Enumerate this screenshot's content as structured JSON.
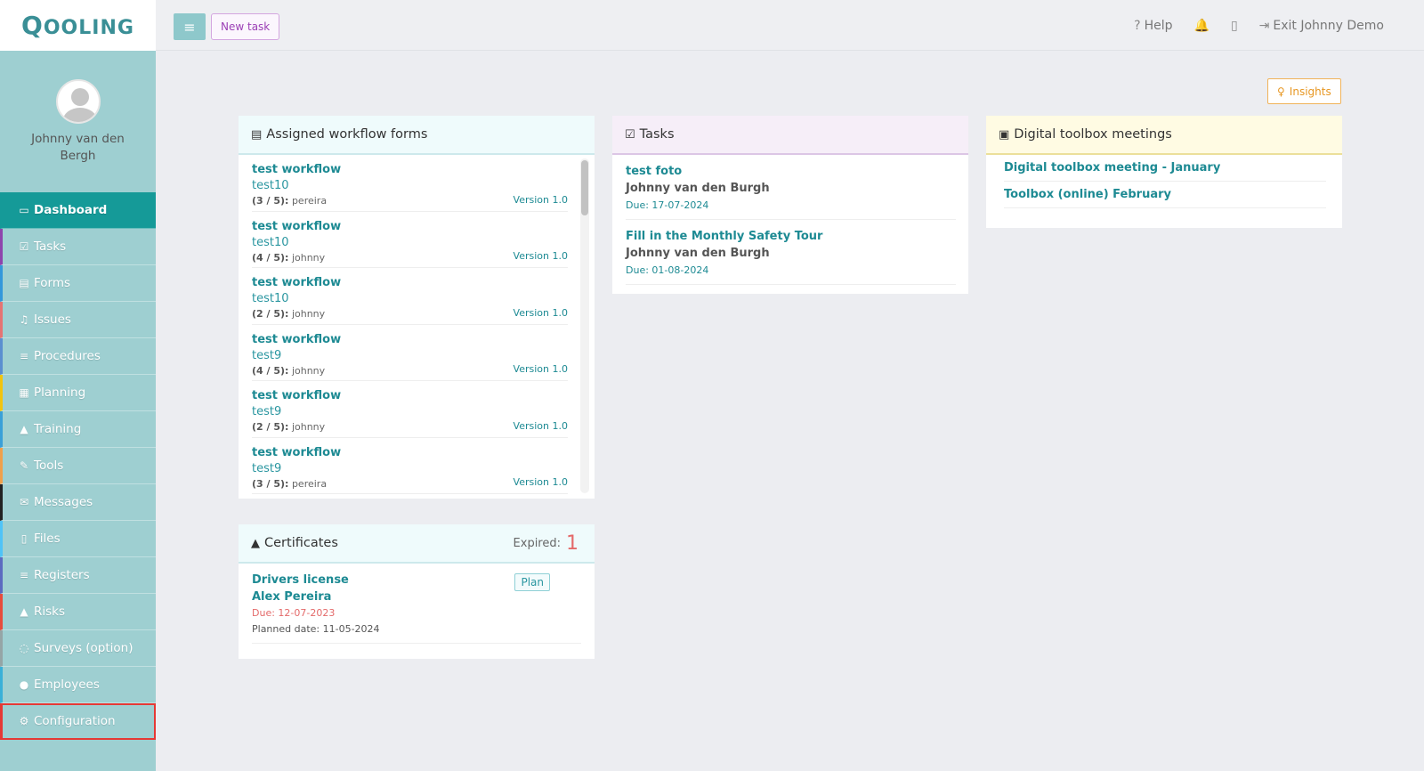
{
  "logo": {
    "first": "Q",
    "rest": "OOLING"
  },
  "topbar": {
    "new_task_label": "New task",
    "help_label": "Help",
    "exit_label": "Exit Johnny Demo"
  },
  "profile": {
    "name": "Johnny van den Bergh"
  },
  "sidebar": {
    "items": [
      {
        "label": "Dashboard",
        "icon": "desktop-icon",
        "glyph": "▭",
        "color": "#159a98"
      },
      {
        "label": "Tasks",
        "icon": "check-square-icon",
        "glyph": "☑",
        "color": "#8e44ad"
      },
      {
        "label": "Forms",
        "icon": "document-icon",
        "glyph": "▤",
        "color": "#3498db"
      },
      {
        "label": "Issues",
        "icon": "bell-icon",
        "glyph": "♫",
        "color": "#e57373"
      },
      {
        "label": "Procedures",
        "icon": "list-icon",
        "glyph": "≡",
        "color": "#5b8fd0"
      },
      {
        "label": "Planning",
        "icon": "calendar-icon",
        "glyph": "▦",
        "color": "#f1c40f"
      },
      {
        "label": "Training",
        "icon": "graduation-cap-icon",
        "glyph": "▲",
        "color": "#3aa0d8"
      },
      {
        "label": "Tools",
        "icon": "wrench-icon",
        "glyph": "✎",
        "color": "#f0a04b"
      },
      {
        "label": "Messages",
        "icon": "envelope-icon",
        "glyph": "✉",
        "color": "#222222"
      },
      {
        "label": "Files",
        "icon": "file-icon",
        "glyph": "▯",
        "color": "#4fc3f7"
      },
      {
        "label": "Registers",
        "icon": "list-icon",
        "glyph": "≡",
        "color": "#5c6bc0"
      },
      {
        "label": "Risks",
        "icon": "warning-icon",
        "glyph": "▲",
        "color": "#e74c3c"
      },
      {
        "label": "Surveys (option)",
        "icon": "comment-icon",
        "glyph": "◌",
        "color": "#95a5a6"
      },
      {
        "label": "Employees",
        "icon": "users-icon",
        "glyph": "●",
        "color": "#3ab0d8"
      },
      {
        "label": "Configuration",
        "icon": "gear-icon",
        "glyph": "⚙",
        "color": "#e53935"
      }
    ]
  },
  "insights_label": "Insights",
  "workflow_panel": {
    "title": "Assigned workflow forms",
    "items": [
      {
        "title": "test workflow",
        "sub": "test10",
        "progress": "(3 / 5):",
        "user": "pereira",
        "version": "Version 1.0"
      },
      {
        "title": "test workflow",
        "sub": "test10",
        "progress": "(4 / 5):",
        "user": "johnny",
        "version": "Version 1.0"
      },
      {
        "title": "test workflow",
        "sub": "test10",
        "progress": "(2 / 5):",
        "user": "johnny",
        "version": "Version 1.0"
      },
      {
        "title": "test workflow",
        "sub": "test9",
        "progress": "(4 / 5):",
        "user": "johnny",
        "version": "Version 1.0"
      },
      {
        "title": "test workflow",
        "sub": "test9",
        "progress": "(2 / 5):",
        "user": "johnny",
        "version": "Version 1.0"
      },
      {
        "title": "test workflow",
        "sub": "test9",
        "progress": "(3 / 5):",
        "user": "pereira",
        "version": "Version 1.0"
      }
    ]
  },
  "tasks_panel": {
    "title": "Tasks",
    "items": [
      {
        "title": "test foto",
        "who": "Johnny van den Burgh",
        "due": "Due: 17-07-2024"
      },
      {
        "title": "Fill in the Monthly Safety Tour",
        "who": "Johnny van den Burgh",
        "due": "Due: 01-08-2024"
      }
    ]
  },
  "toolbox_panel": {
    "title": "Digital toolbox meetings",
    "items": [
      "Digital toolbox meeting - January",
      "Toolbox (online) February"
    ]
  },
  "certificates_panel": {
    "title": "Certificates",
    "expired_label": "Expired:",
    "expired_count": "1",
    "items": [
      {
        "title": "Drivers license",
        "who": "Alex Pereira",
        "due": "Due: 12-07-2023",
        "planned": "Planned date: 11-05-2024",
        "badge": "Plan"
      }
    ]
  }
}
